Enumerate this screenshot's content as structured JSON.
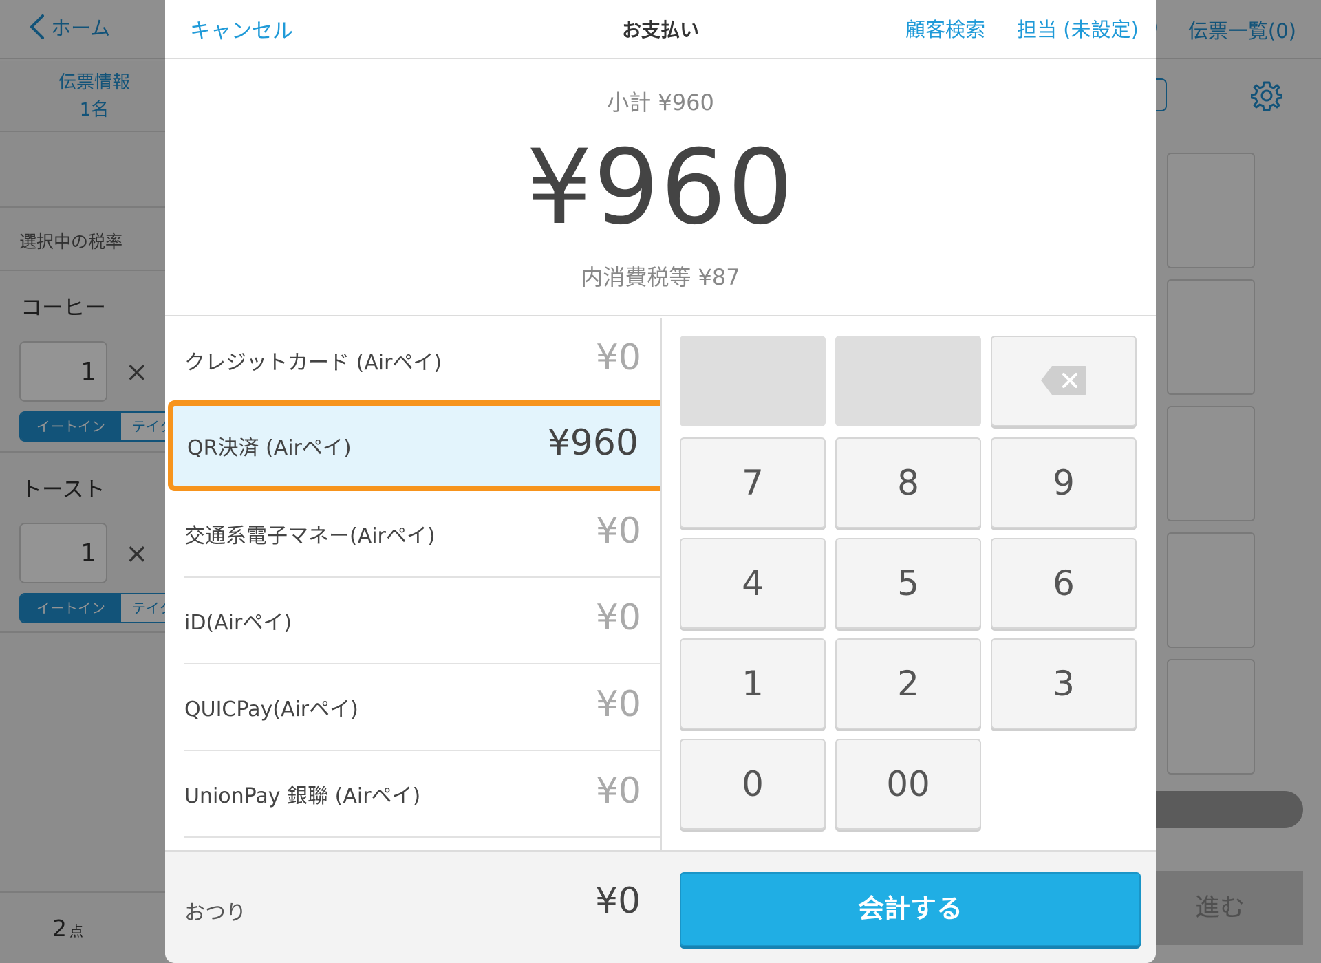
{
  "background_app": {
    "home_label": "ホーム",
    "slip_info_label": "伝票情報",
    "slip_info_people": "1名",
    "tax_rate_label": "選択中の税率",
    "items": [
      {
        "name": "コーヒー",
        "qty": "1",
        "eat_in": "イートイン",
        "takeout": "テイク"
      },
      {
        "name": "トースト",
        "qty": "1",
        "eat_in": "イートイン",
        "takeout": "テイク"
      }
    ],
    "times_symbol": "×",
    "item_count": "2",
    "item_count_unit": "点",
    "slip_list_label": "伝票一覧(0)",
    "top_paren": ")",
    "next_button_label": "進む"
  },
  "modal": {
    "cancel_label": "キャンセル",
    "title": "お支払い",
    "customer_search_label": "顧客検索",
    "staff_label": "担当 (未設定)",
    "subtotal": "小計 ¥960",
    "total": "¥960",
    "tax_included": "内消費税等 ¥87",
    "payment_methods": [
      {
        "label": "クレジットカード (Airペイ)",
        "amount": "¥0",
        "selected": false
      },
      {
        "label": "QR決済 (Airペイ)",
        "amount": "¥960",
        "selected": true
      },
      {
        "label": "交通系電子マネー(Airペイ)",
        "amount": "¥0",
        "selected": false
      },
      {
        "label": "iD(Airペイ)",
        "amount": "¥0",
        "selected": false
      },
      {
        "label": "QUICPay(Airペイ)",
        "amount": "¥0",
        "selected": false
      },
      {
        "label": "UnionPay 銀聯 (Airペイ)",
        "amount": "¥0",
        "selected": false
      }
    ],
    "keypad": {
      "row1": [
        "7",
        "8",
        "9"
      ],
      "row2": [
        "4",
        "5",
        "6"
      ],
      "row3": [
        "1",
        "2",
        "3"
      ],
      "row4": [
        "0",
        "00"
      ]
    },
    "change_label": "おつり",
    "change_value": "¥0",
    "checkout_label": "会計する",
    "colors": {
      "accent": "#20aee4",
      "highlight": "#f7941d",
      "selected_bg": "#e3f4fc"
    }
  }
}
